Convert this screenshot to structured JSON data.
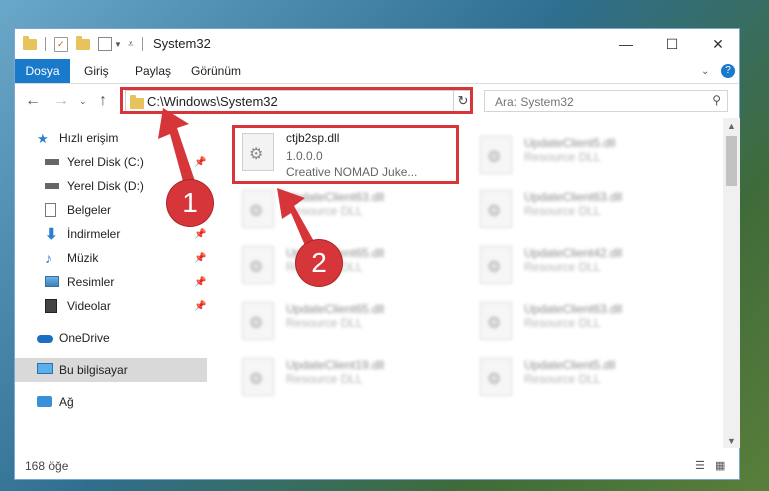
{
  "window": {
    "title": "System32",
    "controls": {
      "minimize": "—",
      "maximize": "☐",
      "close": "✕"
    }
  },
  "ribbon": {
    "file_tab": "Dosya",
    "tabs": [
      "Giriş",
      "Paylaş",
      "Görünüm"
    ]
  },
  "address": {
    "path": "C:\\Windows\\System32",
    "refresh_glyph": "↻",
    "dropdown_glyph": "⌄"
  },
  "search": {
    "placeholder": "Ara: System32",
    "icon": "search-icon"
  },
  "sidebar": {
    "items": [
      {
        "label": "Hızlı erişim",
        "icon": "star-icon"
      },
      {
        "label": "Yerel Disk (C:)",
        "icon": "drive-icon",
        "pinned": true
      },
      {
        "label": "Yerel Disk (D:)",
        "icon": "drive-icon",
        "pinned": true
      },
      {
        "label": "Belgeler",
        "icon": "documents-icon",
        "pinned": true
      },
      {
        "label": "İndirmeler",
        "icon": "download-icon",
        "pinned": true
      },
      {
        "label": "Müzik",
        "icon": "music-icon",
        "pinned": true
      },
      {
        "label": "Resimler",
        "icon": "pictures-icon",
        "pinned": true
      },
      {
        "label": "Videolar",
        "icon": "videos-icon",
        "pinned": true
      },
      {
        "label": "OneDrive",
        "icon": "cloud-icon"
      },
      {
        "label": "Bu bilgisayar",
        "icon": "computer-icon",
        "selected": true
      },
      {
        "label": "Ağ",
        "icon": "network-icon"
      }
    ]
  },
  "files": {
    "highlighted": {
      "name": "ctjb2sp.dll",
      "version": "1.0.0.0",
      "description": "Creative NOMAD Juke..."
    },
    "left_column": [
      {
        "name": "UpdateClient63.dll",
        "type": "Resource DLL"
      },
      {
        "name": "UpdateClient65.dll",
        "type": "Resource DLL"
      },
      {
        "name": "UpdateClient65.dll",
        "type": "Resource DLL"
      },
      {
        "name": "UpdateClient19.dll",
        "type": "Resource DLL"
      }
    ],
    "right_column": [
      {
        "name": "UpdateClient5.dll",
        "type": "Resource DLL"
      },
      {
        "name": "UpdateClient63.dll",
        "type": "Resource DLL"
      },
      {
        "name": "UpdateClient42.dll",
        "type": "Resource DLL"
      },
      {
        "name": "UpdateClient63.dll",
        "type": "Resource DLL"
      },
      {
        "name": "UpdateClient5.dll",
        "type": "Resource DLL"
      }
    ]
  },
  "status": {
    "count": "168 öğe"
  },
  "annotations": {
    "badge1": "1",
    "badge2": "2"
  },
  "colors": {
    "accent": "#1979ca",
    "highlight": "#d6363a",
    "selected_bg": "#d9d9d9"
  }
}
